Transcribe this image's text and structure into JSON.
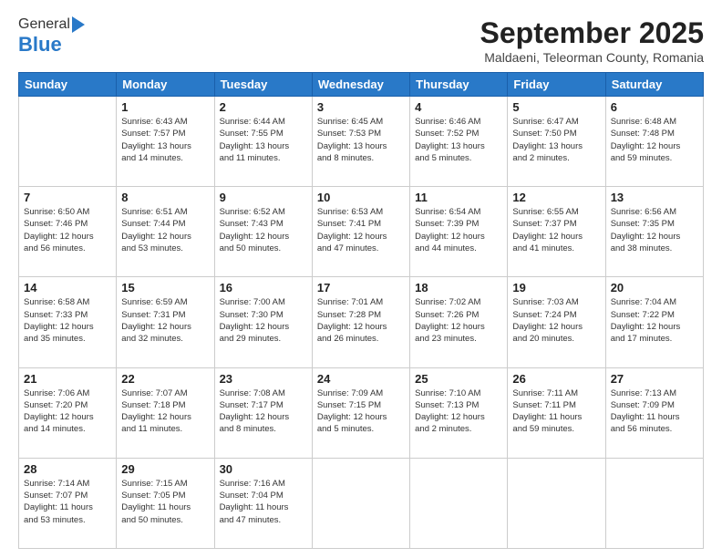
{
  "logo": {
    "general": "General",
    "blue": "Blue"
  },
  "title": "September 2025",
  "subtitle": "Maldaeni, Teleorman County, Romania",
  "days_of_week": [
    "Sunday",
    "Monday",
    "Tuesday",
    "Wednesday",
    "Thursday",
    "Friday",
    "Saturday"
  ],
  "weeks": [
    [
      {
        "day": "",
        "info": ""
      },
      {
        "day": "1",
        "info": "Sunrise: 6:43 AM\nSunset: 7:57 PM\nDaylight: 13 hours\nand 14 minutes."
      },
      {
        "day": "2",
        "info": "Sunrise: 6:44 AM\nSunset: 7:55 PM\nDaylight: 13 hours\nand 11 minutes."
      },
      {
        "day": "3",
        "info": "Sunrise: 6:45 AM\nSunset: 7:53 PM\nDaylight: 13 hours\nand 8 minutes."
      },
      {
        "day": "4",
        "info": "Sunrise: 6:46 AM\nSunset: 7:52 PM\nDaylight: 13 hours\nand 5 minutes."
      },
      {
        "day": "5",
        "info": "Sunrise: 6:47 AM\nSunset: 7:50 PM\nDaylight: 13 hours\nand 2 minutes."
      },
      {
        "day": "6",
        "info": "Sunrise: 6:48 AM\nSunset: 7:48 PM\nDaylight: 12 hours\nand 59 minutes."
      }
    ],
    [
      {
        "day": "7",
        "info": "Sunrise: 6:50 AM\nSunset: 7:46 PM\nDaylight: 12 hours\nand 56 minutes."
      },
      {
        "day": "8",
        "info": "Sunrise: 6:51 AM\nSunset: 7:44 PM\nDaylight: 12 hours\nand 53 minutes."
      },
      {
        "day": "9",
        "info": "Sunrise: 6:52 AM\nSunset: 7:43 PM\nDaylight: 12 hours\nand 50 minutes."
      },
      {
        "day": "10",
        "info": "Sunrise: 6:53 AM\nSunset: 7:41 PM\nDaylight: 12 hours\nand 47 minutes."
      },
      {
        "day": "11",
        "info": "Sunrise: 6:54 AM\nSunset: 7:39 PM\nDaylight: 12 hours\nand 44 minutes."
      },
      {
        "day": "12",
        "info": "Sunrise: 6:55 AM\nSunset: 7:37 PM\nDaylight: 12 hours\nand 41 minutes."
      },
      {
        "day": "13",
        "info": "Sunrise: 6:56 AM\nSunset: 7:35 PM\nDaylight: 12 hours\nand 38 minutes."
      }
    ],
    [
      {
        "day": "14",
        "info": "Sunrise: 6:58 AM\nSunset: 7:33 PM\nDaylight: 12 hours\nand 35 minutes."
      },
      {
        "day": "15",
        "info": "Sunrise: 6:59 AM\nSunset: 7:31 PM\nDaylight: 12 hours\nand 32 minutes."
      },
      {
        "day": "16",
        "info": "Sunrise: 7:00 AM\nSunset: 7:30 PM\nDaylight: 12 hours\nand 29 minutes."
      },
      {
        "day": "17",
        "info": "Sunrise: 7:01 AM\nSunset: 7:28 PM\nDaylight: 12 hours\nand 26 minutes."
      },
      {
        "day": "18",
        "info": "Sunrise: 7:02 AM\nSunset: 7:26 PM\nDaylight: 12 hours\nand 23 minutes."
      },
      {
        "day": "19",
        "info": "Sunrise: 7:03 AM\nSunset: 7:24 PM\nDaylight: 12 hours\nand 20 minutes."
      },
      {
        "day": "20",
        "info": "Sunrise: 7:04 AM\nSunset: 7:22 PM\nDaylight: 12 hours\nand 17 minutes."
      }
    ],
    [
      {
        "day": "21",
        "info": "Sunrise: 7:06 AM\nSunset: 7:20 PM\nDaylight: 12 hours\nand 14 minutes."
      },
      {
        "day": "22",
        "info": "Sunrise: 7:07 AM\nSunset: 7:18 PM\nDaylight: 12 hours\nand 11 minutes."
      },
      {
        "day": "23",
        "info": "Sunrise: 7:08 AM\nSunset: 7:17 PM\nDaylight: 12 hours\nand 8 minutes."
      },
      {
        "day": "24",
        "info": "Sunrise: 7:09 AM\nSunset: 7:15 PM\nDaylight: 12 hours\nand 5 minutes."
      },
      {
        "day": "25",
        "info": "Sunrise: 7:10 AM\nSunset: 7:13 PM\nDaylight: 12 hours\nand 2 minutes."
      },
      {
        "day": "26",
        "info": "Sunrise: 7:11 AM\nSunset: 7:11 PM\nDaylight: 11 hours\nand 59 minutes."
      },
      {
        "day": "27",
        "info": "Sunrise: 7:13 AM\nSunset: 7:09 PM\nDaylight: 11 hours\nand 56 minutes."
      }
    ],
    [
      {
        "day": "28",
        "info": "Sunrise: 7:14 AM\nSunset: 7:07 PM\nDaylight: 11 hours\nand 53 minutes."
      },
      {
        "day": "29",
        "info": "Sunrise: 7:15 AM\nSunset: 7:05 PM\nDaylight: 11 hours\nand 50 minutes."
      },
      {
        "day": "30",
        "info": "Sunrise: 7:16 AM\nSunset: 7:04 PM\nDaylight: 11 hours\nand 47 minutes."
      },
      {
        "day": "",
        "info": ""
      },
      {
        "day": "",
        "info": ""
      },
      {
        "day": "",
        "info": ""
      },
      {
        "day": "",
        "info": ""
      }
    ]
  ]
}
